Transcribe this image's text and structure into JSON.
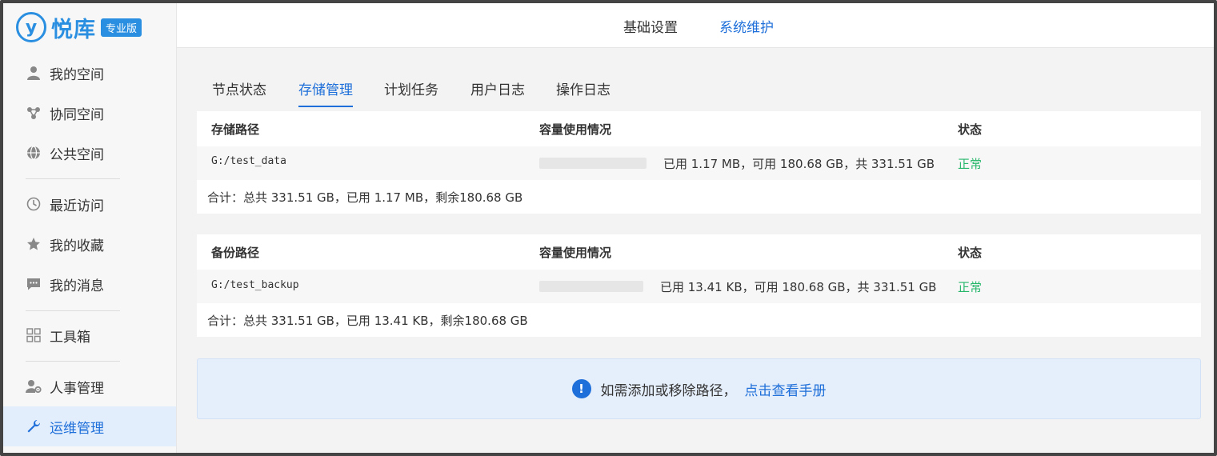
{
  "app": {
    "logo_mark": "y",
    "name": "悦库",
    "edition": "专业版",
    "brand_color": "#2a8fe0",
    "accent_color": "#1e6fd9"
  },
  "sidebar": {
    "items": [
      {
        "label": "我的空间",
        "icon": "user-icon"
      },
      {
        "label": "协同空间",
        "icon": "collaboration-icon"
      },
      {
        "label": "公共空间",
        "icon": "globe-icon"
      },
      {
        "label": "最近访问",
        "icon": "history-icon"
      },
      {
        "label": "我的收藏",
        "icon": "star-icon"
      },
      {
        "label": "我的消息",
        "icon": "message-icon"
      },
      {
        "label": "工具箱",
        "icon": "grid-icon"
      },
      {
        "label": "人事管理",
        "icon": "user-settings-icon"
      },
      {
        "label": "运维管理",
        "icon": "wrench-icon",
        "active": true
      }
    ]
  },
  "topbar": {
    "tabs": [
      {
        "label": "基础设置"
      },
      {
        "label": "系统维护",
        "active": true
      }
    ]
  },
  "subtabs": [
    {
      "label": "节点状态"
    },
    {
      "label": "存储管理",
      "active": true
    },
    {
      "label": "计划任务"
    },
    {
      "label": "用户日志"
    },
    {
      "label": "操作日志"
    }
  ],
  "storage": {
    "headers": {
      "path": "存储路径",
      "usage": "容量使用情况",
      "status": "状态"
    },
    "rows": [
      {
        "path": "G:/test_data",
        "used_fraction": 0.0,
        "usage": "已用 1.17 MB，可用 180.68 GB，共 331.51 GB",
        "status": "正常"
      }
    ],
    "total": "合计：总共 331.51 GB，已用 1.17 MB，剩余180.68 GB"
  },
  "backup": {
    "headers": {
      "path": "备份路径",
      "usage": "容量使用情况",
      "status": "状态"
    },
    "rows": [
      {
        "path": "G:/test_backup",
        "used_fraction": 0.0,
        "usage": "已用 13.41 KB，可用 180.68 GB，共 331.51 GB",
        "status": "正常"
      }
    ],
    "total": "合计：总共 331.51 GB，已用 13.41 KB，剩余180.68 GB"
  },
  "notice": {
    "text": "如需添加或移除路径，",
    "link": "点击查看手册",
    "icon": "info-icon"
  },
  "status_ok_color": "#26b76b"
}
